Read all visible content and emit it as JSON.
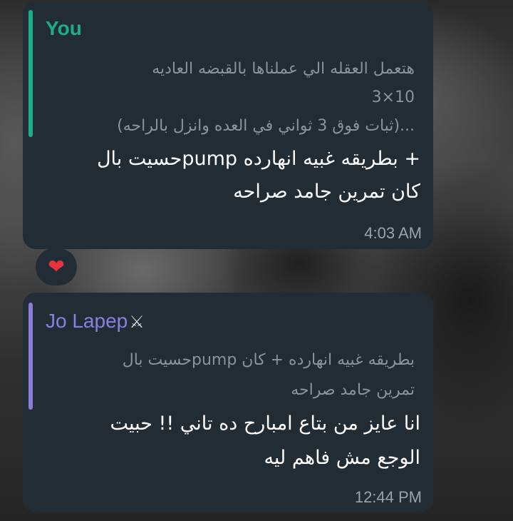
{
  "messages": [
    {
      "reply_to": {
        "author": "You",
        "lines": [
          "هتعمل العقله الي عملناها بالقبضه العاديه",
          "3×10",
          "(ثبات فوق 3 ثواني في العده وانزل بالراحه)..."
        ]
      },
      "text_lines": [
        "حسيت بالpump بطريقه غبيه انهارده +",
        "كان تمرين جامد صراحه"
      ],
      "time": "4:03 AM",
      "reaction": "❤"
    },
    {
      "reply_to": {
        "author": "Jo Lapep",
        "author_badge": "⚔",
        "lines": [
          "حسيت بالpump بطريقه غبيه انهارده + كان",
          "تمرين جامد صراحه"
        ]
      },
      "text_lines": [
        "انا عايز من بتاع امبارح ده تاني !! حبيت",
        "الوجع مش فاهم ليه"
      ],
      "time": "12:44 PM"
    }
  ],
  "colors": {
    "bubble": "#222c35",
    "reply_you": "#1bae8a",
    "reply_other": "#8a7bd6",
    "heart": "#e8323c"
  }
}
